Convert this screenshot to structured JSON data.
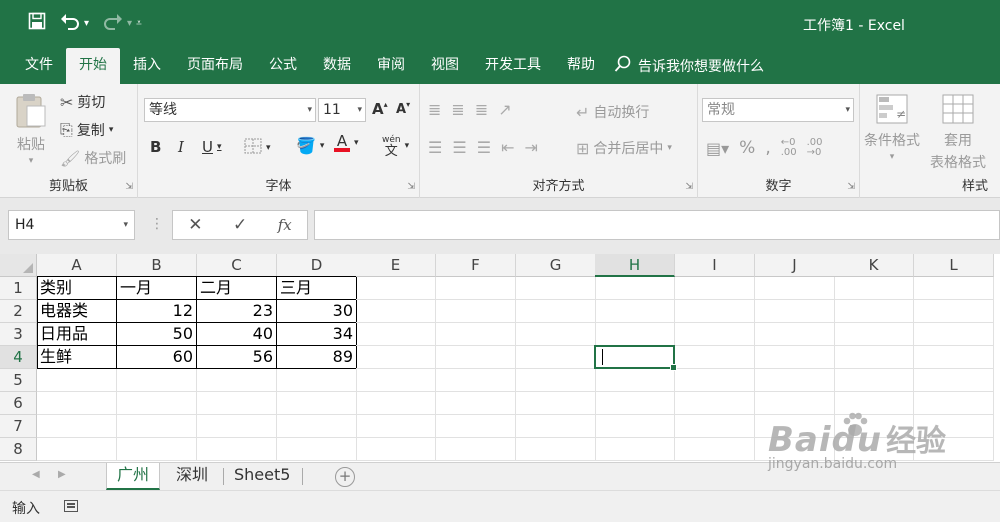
{
  "window": {
    "title": "工作簿1  -  Excel"
  },
  "qat": {
    "save_icon": "save-icon",
    "undo_icon": "undo-icon",
    "redo_icon": "redo-icon"
  },
  "tabs": [
    {
      "label": "文件"
    },
    {
      "label": "开始"
    },
    {
      "label": "插入"
    },
    {
      "label": "页面布局"
    },
    {
      "label": "公式"
    },
    {
      "label": "数据"
    },
    {
      "label": "审阅"
    },
    {
      "label": "视图"
    },
    {
      "label": "开发工具"
    },
    {
      "label": "帮助"
    }
  ],
  "tell_me": "告诉我你想要做什么",
  "ribbon": {
    "clipboard": {
      "paste": "粘贴",
      "cut": "剪切",
      "copy": "复制",
      "format_painter": "格式刷",
      "label": "剪贴板"
    },
    "font": {
      "name": "等线",
      "size": "11",
      "label": "字体",
      "bold": "B",
      "italic": "I",
      "underline": "U",
      "font_color_letter": "A",
      "grow": "A",
      "shrink": "A",
      "wen": "wén",
      "wen_char": "文"
    },
    "alignment": {
      "wrap": "自动换行",
      "merge": "合并后居中",
      "label": "对齐方式"
    },
    "number": {
      "format": "常规",
      "label": "数字",
      "percent": "%",
      "comma": ","
    },
    "styles": {
      "conditional": "条件格式",
      "table_format": "套用",
      "table_format2": "表格格式",
      "label": "样式"
    }
  },
  "formula_bar": {
    "name_box": "H4",
    "cancel": "✕",
    "enter": "✓",
    "fx": "fx",
    "formula": ""
  },
  "columns": [
    "A",
    "B",
    "C",
    "D",
    "E",
    "F",
    "G",
    "H",
    "I",
    "J",
    "K",
    "L"
  ],
  "rows": [
    "1",
    "2",
    "3",
    "4",
    "5",
    "6",
    "7",
    "8"
  ],
  "cells": {
    "A1": "类别",
    "B1": "一月",
    "C1": "二月",
    "D1": "三月",
    "A2": "电器类",
    "B2": "12",
    "C2": "23",
    "D2": "30",
    "A3": "日用品",
    "B3": "50",
    "C3": "40",
    "D3": "34",
    "A4": "生鲜",
    "B4": "60",
    "C4": "56",
    "D4": "89"
  },
  "active_cell": "H4",
  "sheets": [
    {
      "label": "广州",
      "active": true
    },
    {
      "label": "深圳",
      "active": false
    },
    {
      "label": "Sheet5",
      "active": false
    }
  ],
  "status": {
    "mode": "输入"
  },
  "watermark": {
    "logo": "Bai",
    "logo2": "du",
    "cn": "经验",
    "url": "jingyan.baidu.com"
  },
  "colors": {
    "accent": "#217346",
    "ribbon_bg": "#f3f3f3"
  }
}
